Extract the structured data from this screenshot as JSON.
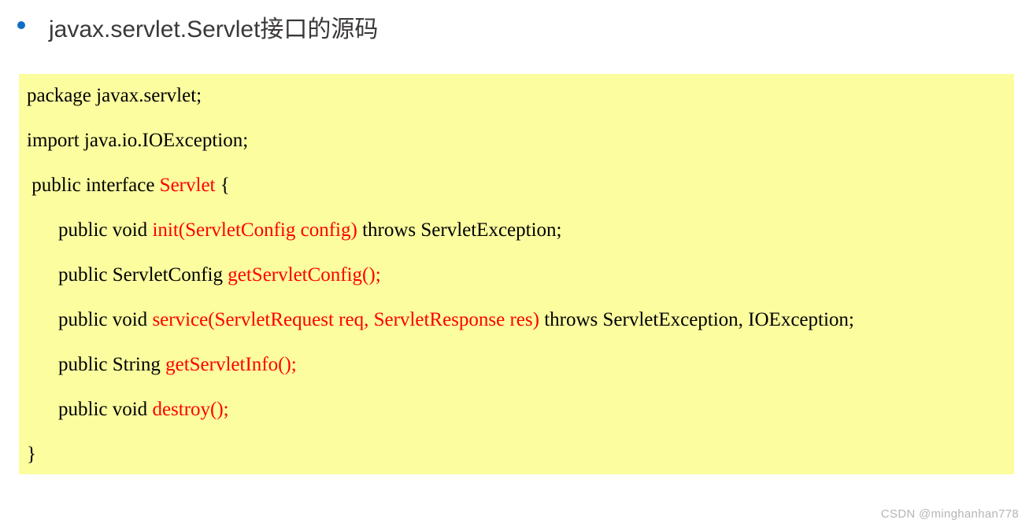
{
  "heading": "javax.servlet.Servlet接口的源码",
  "code": {
    "l1": "package javax.servlet;",
    "l2": "import java.io.IOException;",
    "l3a": " public interface ",
    "l3b": "Servlet",
    "l3c": " {",
    "l4a": "public void ",
    "l4b": "init(ServletConfig config)",
    "l4c": " throws ServletException;",
    "l5a": "public ServletConfig ",
    "l5b": "getServletConfig();",
    "l6a": "public void ",
    "l6b": "service(ServletRequest req, ServletResponse res)",
    "l6c": " throws ServletException, IOException;",
    "l7a": "public String ",
    "l7b": "getServletInfo();",
    "l8a": "public void ",
    "l8b": "destroy();",
    "l9": "}"
  },
  "watermark": "CSDN @minghanhan778"
}
